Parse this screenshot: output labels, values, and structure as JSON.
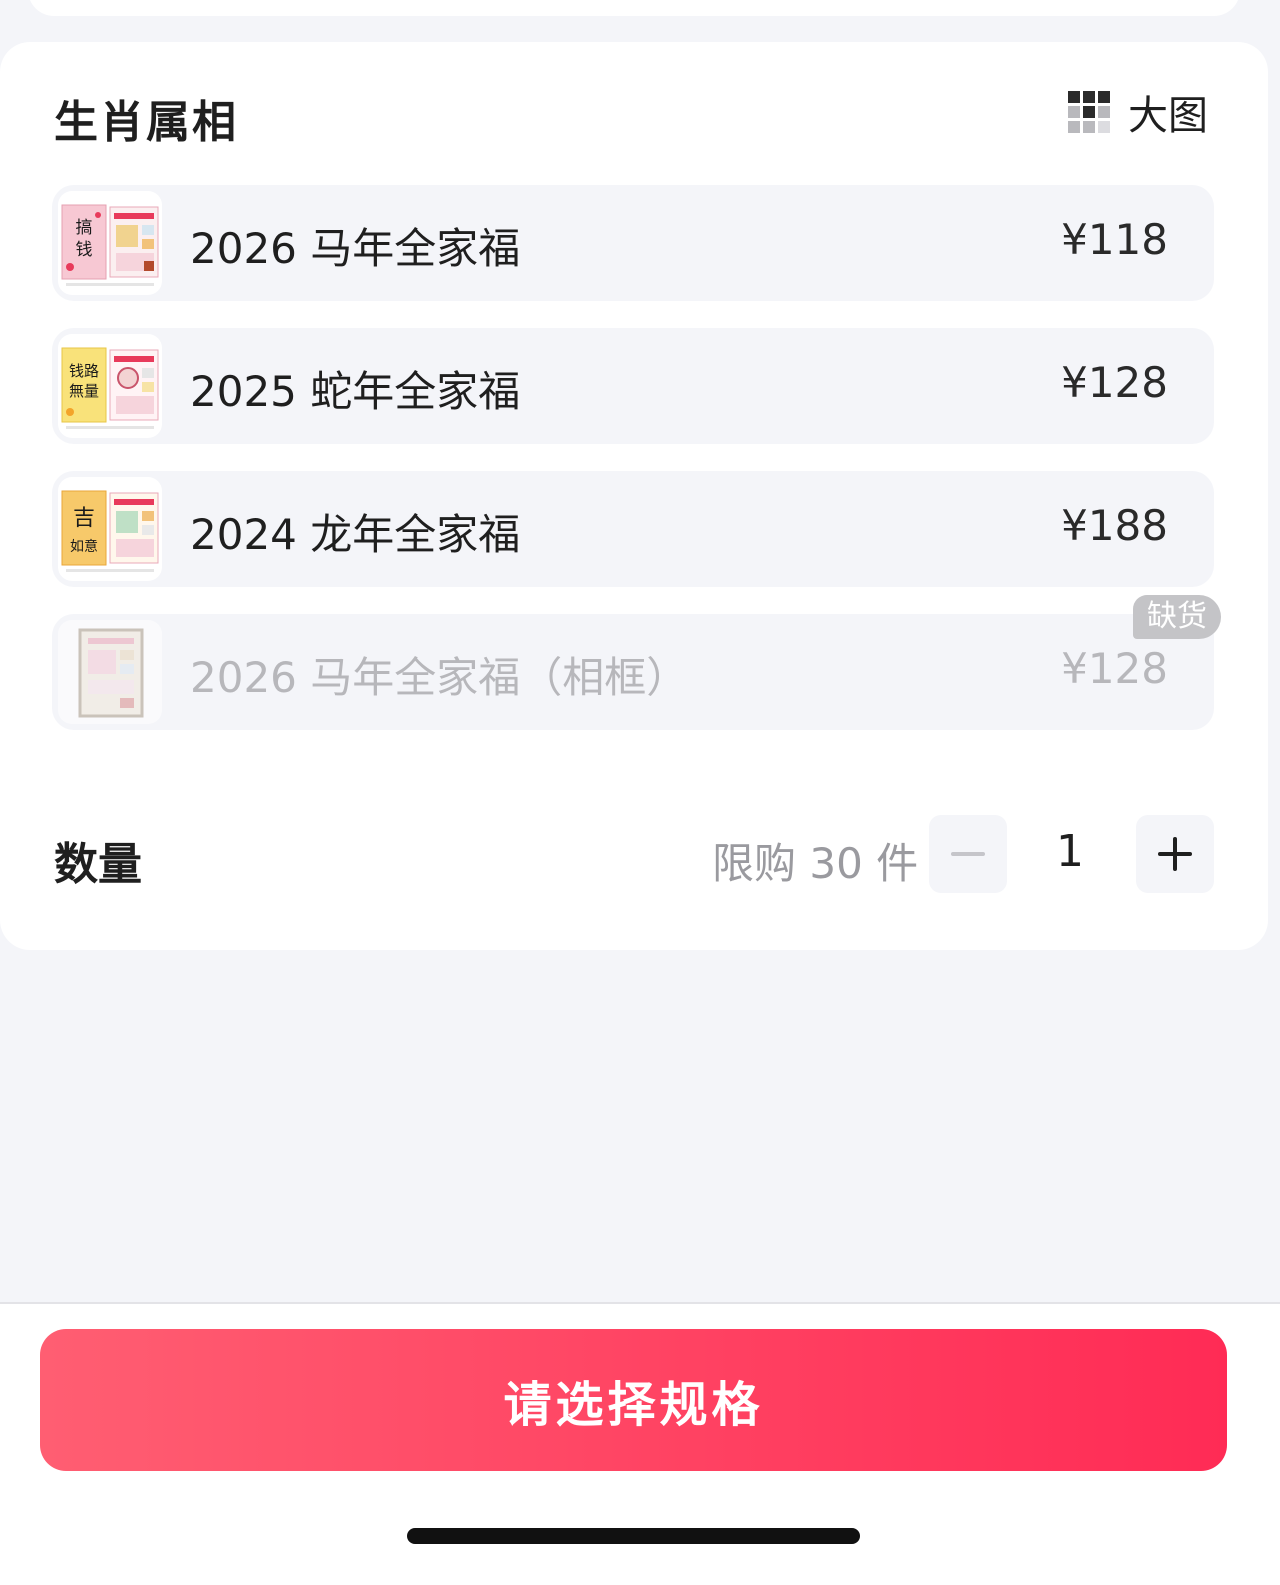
{
  "spec_section": {
    "title": "生肖属相",
    "big_view_label": "大图",
    "options": [
      {
        "name": "2026 马年全家福",
        "price": "¥118",
        "available": true,
        "thumb_accent": "#e83a5b",
        "thumb_glyph": "搞钱"
      },
      {
        "name": "2025 蛇年全家福",
        "price": "¥128",
        "available": true,
        "thumb_accent": "#f3c21f",
        "thumb_glyph": "钱路"
      },
      {
        "name": "2024 龙年全家福",
        "price": "¥188",
        "available": true,
        "thumb_accent": "#f2a23a",
        "thumb_glyph": "吉"
      },
      {
        "name": "2026 马年全家福（相框）",
        "price": "¥128",
        "available": false,
        "thumb_accent": "#d9c7a4",
        "thumb_glyph": ""
      }
    ],
    "soldout_label": "缺货"
  },
  "quantity": {
    "label": "数量",
    "limit_text": "限购 30 件",
    "value": "1"
  },
  "footer": {
    "cta_label": "请选择规格"
  },
  "colors": {
    "cta_start": "#ff5e72",
    "cta_end": "#ff2b55",
    "page_bg": "#f4f5f9"
  }
}
